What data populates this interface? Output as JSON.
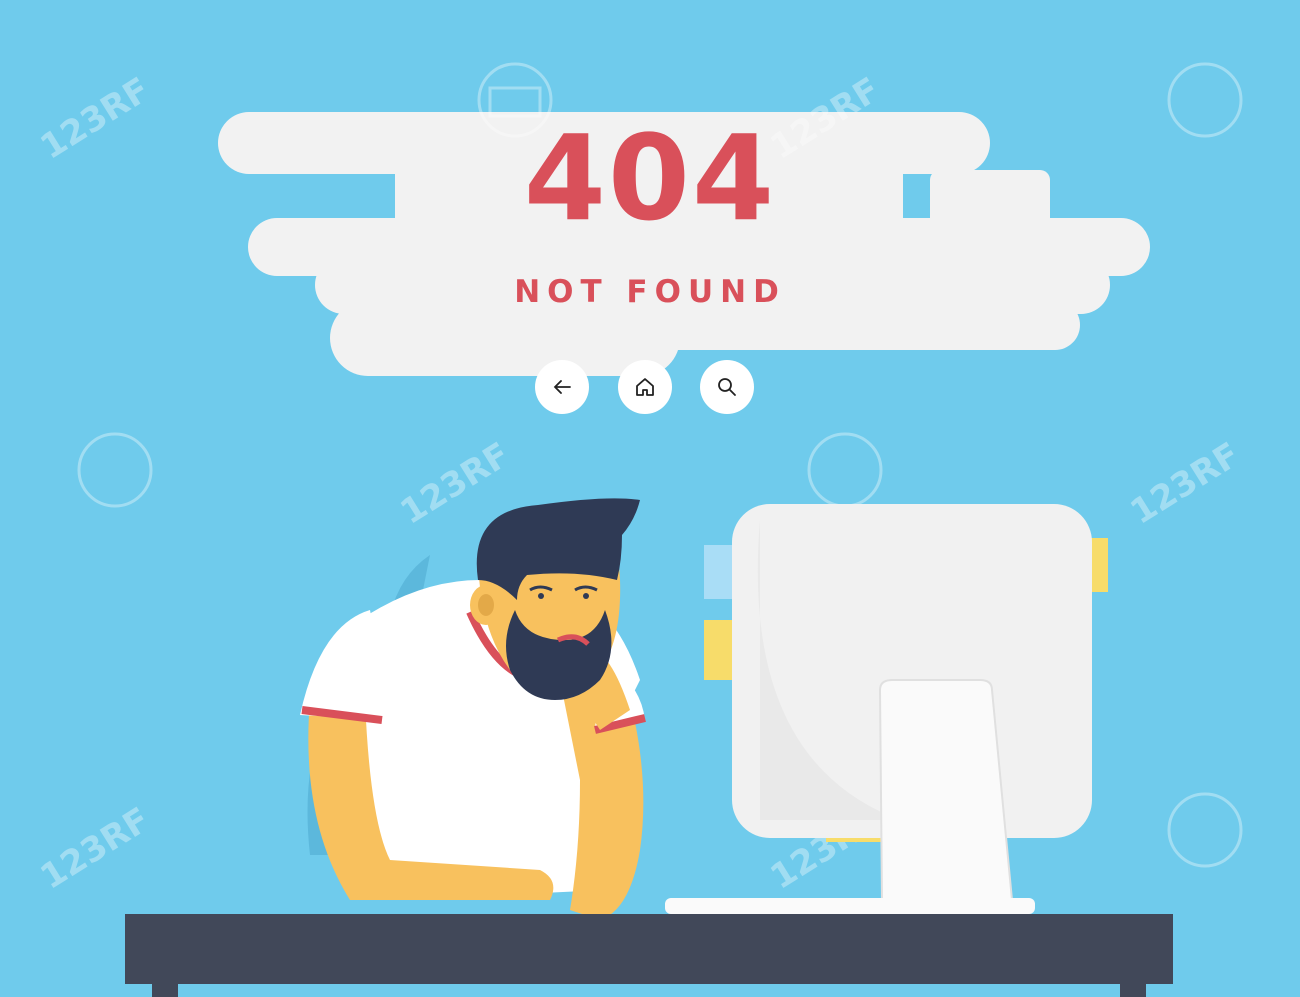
{
  "colors": {
    "background": "#6fcbec",
    "cloud": "#f2f2f2",
    "accent_red": "#d9505a",
    "hair": "#2f3a55",
    "skin": "#f8c15e",
    "desk": "#414859",
    "monitor": "#f1f1f1",
    "sticky_yellow": "#f7dc6a",
    "sticky_blue": "#a9ddf6",
    "watermark": "#ffffff"
  },
  "error": {
    "code": "404",
    "message": "NOT FOUND"
  },
  "nav": {
    "back_icon": "arrow-left-icon",
    "home_icon": "home-icon",
    "search_icon": "search-icon"
  },
  "watermark": {
    "text": "123RF"
  }
}
